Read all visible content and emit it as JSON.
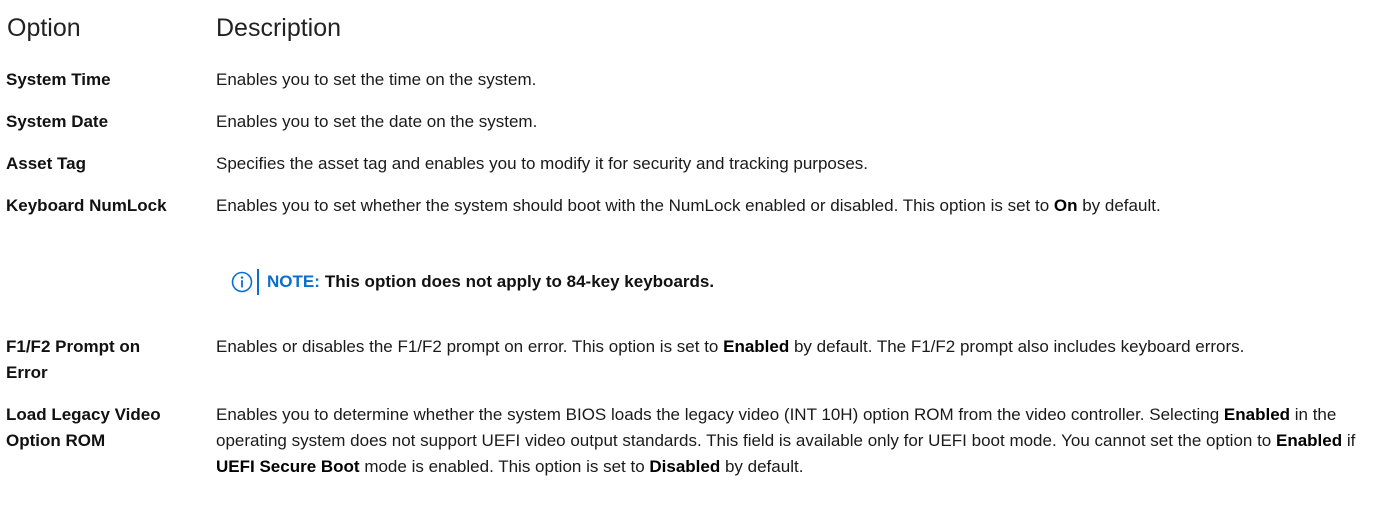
{
  "header": {
    "option": "Option",
    "description": "Description"
  },
  "rows": [
    {
      "option": "System Time",
      "description": "Enables you to set the time on the system."
    },
    {
      "option": "System Date",
      "description": "Enables you to set the date on the system."
    },
    {
      "option": "Asset Tag",
      "description": "Specifies the asset tag and enables you to modify it for security and tracking purposes."
    },
    {
      "option": "Keyboard NumLock",
      "desc_a": "Enables you to set whether the system should boot with the NumLock enabled or disabled. This option is set to ",
      "desc_b": "On",
      "desc_c": " by default."
    },
    {
      "option_l1": "F1/F2 Prompt on",
      "option_l2": "Error",
      "desc_a": "Enables or disables the F1/F2 prompt on error. This option is set to ",
      "desc_b": "Enabled",
      "desc_c": " by default. The F1/F2 prompt also includes keyboard errors."
    },
    {
      "option_l1": "Load Legacy Video",
      "option_l2": "Option ROM",
      "desc_a": "Enables you to determine whether the system BIOS loads the legacy video (INT 10H) option ROM from the video controller. Selecting ",
      "desc_b": "Enabled",
      "desc_c": " in the operating system does not support UEFI video output standards. This field is available only for UEFI boot mode. You cannot set the option to ",
      "desc_d": "Enabled",
      "desc_e": " if ",
      "desc_f": "UEFI Secure Boot",
      "desc_g": " mode is enabled. This option is set to ",
      "desc_h": "Disabled",
      "desc_i": " by default."
    }
  ],
  "note": {
    "label": "NOTE:",
    "text": "This option does not apply to 84-key keyboards.",
    "icon": "info-icon",
    "accent_color": "#0a6ed1"
  }
}
